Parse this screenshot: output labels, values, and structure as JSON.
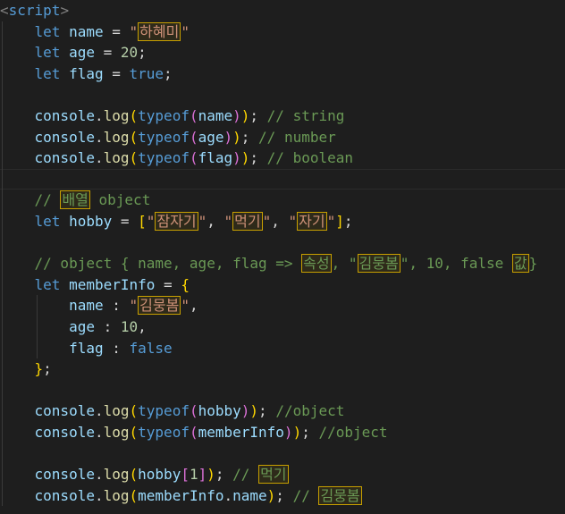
{
  "lines": [
    [
      {
        "t": "<",
        "c": "tagp"
      },
      {
        "t": "script",
        "c": "tag"
      },
      {
        "t": ">",
        "c": "tagp"
      }
    ],
    [
      {
        "t": "    "
      },
      {
        "t": "let",
        "c": "kw"
      },
      {
        "t": " "
      },
      {
        "t": "name",
        "c": "id"
      },
      {
        "t": " = "
      },
      {
        "t": "\"",
        "c": "str"
      },
      {
        "t": "하혜미",
        "c": "str",
        "hl": true
      },
      {
        "t": "\"",
        "c": "str"
      }
    ],
    [
      {
        "t": "    "
      },
      {
        "t": "let",
        "c": "kw"
      },
      {
        "t": " "
      },
      {
        "t": "age",
        "c": "id"
      },
      {
        "t": " = "
      },
      {
        "t": "20",
        "c": "num"
      },
      {
        "t": ";"
      }
    ],
    [
      {
        "t": "    "
      },
      {
        "t": "let",
        "c": "kw"
      },
      {
        "t": " "
      },
      {
        "t": "flag",
        "c": "id"
      },
      {
        "t": " = "
      },
      {
        "t": "true",
        "c": "kw"
      },
      {
        "t": ";"
      }
    ],
    [],
    [
      {
        "t": "    "
      },
      {
        "t": "console",
        "c": "id"
      },
      {
        "t": "."
      },
      {
        "t": "log",
        "c": "fn"
      },
      {
        "t": "(",
        "c": "p1"
      },
      {
        "t": "typeof",
        "c": "kw"
      },
      {
        "t": "(",
        "c": "p2"
      },
      {
        "t": "name",
        "c": "id"
      },
      {
        "t": ")",
        "c": "p2"
      },
      {
        "t": ")",
        "c": "p1"
      },
      {
        "t": "; "
      },
      {
        "t": "// string",
        "c": "cm"
      }
    ],
    [
      {
        "t": "    "
      },
      {
        "t": "console",
        "c": "id"
      },
      {
        "t": "."
      },
      {
        "t": "log",
        "c": "fn"
      },
      {
        "t": "(",
        "c": "p1"
      },
      {
        "t": "typeof",
        "c": "kw"
      },
      {
        "t": "(",
        "c": "p2"
      },
      {
        "t": "age",
        "c": "id"
      },
      {
        "t": ")",
        "c": "p2"
      },
      {
        "t": ")",
        "c": "p1"
      },
      {
        "t": "; "
      },
      {
        "t": "// number",
        "c": "cm"
      }
    ],
    [
      {
        "t": "    "
      },
      {
        "t": "console",
        "c": "id"
      },
      {
        "t": "."
      },
      {
        "t": "log",
        "c": "fn"
      },
      {
        "t": "(",
        "c": "p1"
      },
      {
        "t": "typeof",
        "c": "kw"
      },
      {
        "t": "(",
        "c": "p2"
      },
      {
        "t": "flag",
        "c": "id"
      },
      {
        "t": ")",
        "c": "p2"
      },
      {
        "t": ")",
        "c": "p1"
      },
      {
        "t": "; "
      },
      {
        "t": "// boolean",
        "c": "cm"
      }
    ],
    [],
    [
      {
        "t": "    "
      },
      {
        "t": "// ",
        "c": "cm"
      },
      {
        "t": "배열",
        "c": "cm",
        "hl": true
      },
      {
        "t": " object",
        "c": "cm"
      }
    ],
    [
      {
        "t": "    "
      },
      {
        "t": "let",
        "c": "kw"
      },
      {
        "t": " "
      },
      {
        "t": "hobby",
        "c": "id"
      },
      {
        "t": " = "
      },
      {
        "t": "[",
        "c": "p1"
      },
      {
        "t": "\"",
        "c": "str"
      },
      {
        "t": "잠자기",
        "c": "str",
        "hl": true
      },
      {
        "t": "\"",
        "c": "str"
      },
      {
        "t": ", "
      },
      {
        "t": "\"",
        "c": "str"
      },
      {
        "t": "먹기",
        "c": "str",
        "hl": true
      },
      {
        "t": "\"",
        "c": "str"
      },
      {
        "t": ", "
      },
      {
        "t": "\"",
        "c": "str"
      },
      {
        "t": "자기",
        "c": "str",
        "hl": true
      },
      {
        "t": "\"",
        "c": "str"
      },
      {
        "t": "]",
        "c": "p1"
      },
      {
        "t": ";"
      }
    ],
    [],
    [
      {
        "t": "    "
      },
      {
        "t": "// object { name, age, flag => ",
        "c": "cm"
      },
      {
        "t": "속성",
        "c": "cm",
        "hl": true
      },
      {
        "t": ", \"",
        "c": "cm"
      },
      {
        "t": "김뭉봄",
        "c": "cm",
        "hl": true
      },
      {
        "t": "\", 10, false ",
        "c": "cm"
      },
      {
        "t": "값",
        "c": "cm",
        "hl": true
      },
      {
        "t": "}",
        "c": "cm"
      }
    ],
    [
      {
        "t": "    "
      },
      {
        "t": "let",
        "c": "kw"
      },
      {
        "t": " "
      },
      {
        "t": "memberInfo",
        "c": "id"
      },
      {
        "t": " = "
      },
      {
        "t": "{",
        "c": "p1"
      }
    ],
    [
      {
        "t": "        "
      },
      {
        "t": "name",
        "c": "id"
      },
      {
        "t": " : "
      },
      {
        "t": "\"",
        "c": "str"
      },
      {
        "t": "김뭉봄",
        "c": "str",
        "hl": true
      },
      {
        "t": "\"",
        "c": "str"
      },
      {
        "t": ","
      }
    ],
    [
      {
        "t": "        "
      },
      {
        "t": "age",
        "c": "id"
      },
      {
        "t": " : "
      },
      {
        "t": "10",
        "c": "num"
      },
      {
        "t": ","
      }
    ],
    [
      {
        "t": "        "
      },
      {
        "t": "flag",
        "c": "id"
      },
      {
        "t": " : "
      },
      {
        "t": "false",
        "c": "kw"
      }
    ],
    [
      {
        "t": "    "
      },
      {
        "t": "}",
        "c": "p1"
      },
      {
        "t": ";"
      }
    ],
    [],
    [
      {
        "t": "    "
      },
      {
        "t": "console",
        "c": "id"
      },
      {
        "t": "."
      },
      {
        "t": "log",
        "c": "fn"
      },
      {
        "t": "(",
        "c": "p1"
      },
      {
        "t": "typeof",
        "c": "kw"
      },
      {
        "t": "(",
        "c": "p2"
      },
      {
        "t": "hobby",
        "c": "id"
      },
      {
        "t": ")",
        "c": "p2"
      },
      {
        "t": ")",
        "c": "p1"
      },
      {
        "t": "; "
      },
      {
        "t": "//object",
        "c": "cm"
      }
    ],
    [
      {
        "t": "    "
      },
      {
        "t": "console",
        "c": "id"
      },
      {
        "t": "."
      },
      {
        "t": "log",
        "c": "fn"
      },
      {
        "t": "(",
        "c": "p1"
      },
      {
        "t": "typeof",
        "c": "kw"
      },
      {
        "t": "(",
        "c": "p2"
      },
      {
        "t": "memberInfo",
        "c": "id"
      },
      {
        "t": ")",
        "c": "p2"
      },
      {
        "t": ")",
        "c": "p1"
      },
      {
        "t": "; "
      },
      {
        "t": "//object",
        "c": "cm"
      }
    ],
    [],
    [
      {
        "t": "    "
      },
      {
        "t": "console",
        "c": "id"
      },
      {
        "t": "."
      },
      {
        "t": "log",
        "c": "fn"
      },
      {
        "t": "(",
        "c": "p1"
      },
      {
        "t": "hobby",
        "c": "id"
      },
      {
        "t": "[",
        "c": "p2"
      },
      {
        "t": "1",
        "c": "num"
      },
      {
        "t": "]",
        "c": "p2"
      },
      {
        "t": ")",
        "c": "p1"
      },
      {
        "t": "; "
      },
      {
        "t": "// ",
        "c": "cm"
      },
      {
        "t": "먹기",
        "c": "cm",
        "hl": true
      }
    ],
    [
      {
        "t": "    "
      },
      {
        "t": "console",
        "c": "id"
      },
      {
        "t": "."
      },
      {
        "t": "log",
        "c": "fn"
      },
      {
        "t": "(",
        "c": "p1"
      },
      {
        "t": "memberInfo",
        "c": "id"
      },
      {
        "t": "."
      },
      {
        "t": "name",
        "c": "id"
      },
      {
        "t": ")",
        "c": "p1"
      },
      {
        "t": "; "
      },
      {
        "t": "// ",
        "c": "cm"
      },
      {
        "t": "김뭉봄",
        "c": "cm",
        "hl": true
      }
    ]
  ]
}
